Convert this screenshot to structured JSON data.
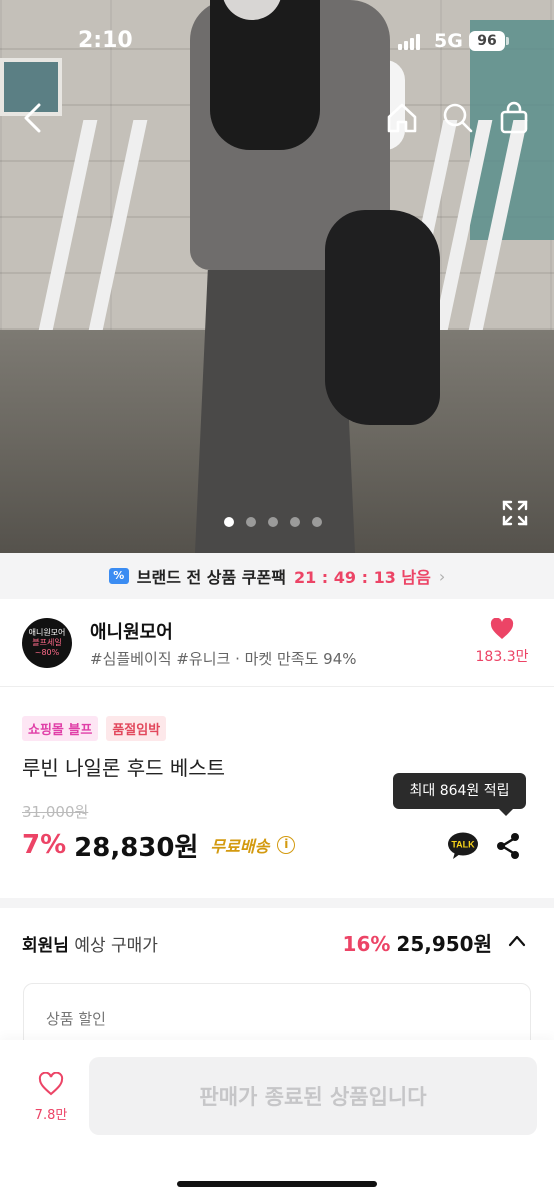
{
  "status_bar": {
    "time": "2:10",
    "network": "5G",
    "battery": "96"
  },
  "hero": {
    "image_count": 5,
    "active_index": 0
  },
  "coupon_bar": {
    "text": "브랜드 전 상품 쿠폰팩",
    "timer": "21 : 49 : 13 남음"
  },
  "store": {
    "logo_lines": [
      "애니원모어",
      "블프세일",
      "~80%"
    ],
    "name": "애니원모어",
    "tags": "#심플베이직 #유니크 · 마켓 만족도 94%",
    "like_count": "183.3만"
  },
  "product": {
    "badges": [
      "쇼핑몰 블프",
      "품절임박"
    ],
    "title": "루빈 나일론 후드 베스트",
    "tooltip": "최대 864원 적립",
    "original_price": "31,000원",
    "discount_percent": "7%",
    "price": "28,830원",
    "shipping": "무료배송"
  },
  "member_price": {
    "label_bold": "회원님",
    "label_rest": " 예상 구매가",
    "discount_percent": "16%",
    "price": "25,950원"
  },
  "discount_section": {
    "label": "상품 할인"
  },
  "bottom_bar": {
    "wish_count": "7.8만",
    "button_label": "판매가 종료된 상품입니다"
  },
  "colors": {
    "accent": "#ec4466",
    "shipping": "#d39a10",
    "disabled_bg": "#f1f1f2"
  }
}
